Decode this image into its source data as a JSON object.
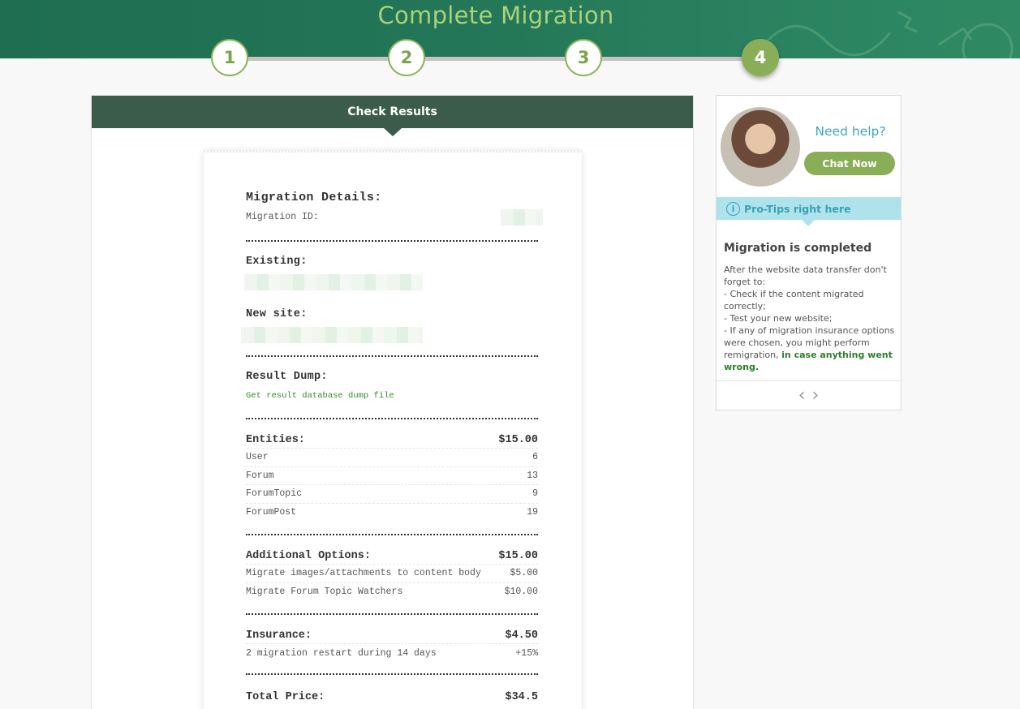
{
  "header": {
    "title": "Complete Migration"
  },
  "steps": [
    {
      "label": "1",
      "state": "done"
    },
    {
      "label": "2",
      "state": "done"
    },
    {
      "label": "3",
      "state": "done"
    },
    {
      "label": "4",
      "state": "active"
    }
  ],
  "main": {
    "title": "Check Results"
  },
  "receipt": {
    "details_title": "Migration Details:",
    "migration_id_label": "Migration ID:",
    "existing_label": "Existing:",
    "new_site_label": "New site:",
    "result_dump_label": "Result Dump:",
    "result_dump_link": "Get result database dump file",
    "entities": {
      "label": "Entities:",
      "total": "$15.00",
      "rows": [
        {
          "name": "User",
          "value": "6"
        },
        {
          "name": "Forum",
          "value": "13"
        },
        {
          "name": "ForumTopic",
          "value": "9"
        },
        {
          "name": "ForumPost",
          "value": "19"
        }
      ]
    },
    "additional": {
      "label": "Additional Options:",
      "total": "$15.00",
      "rows": [
        {
          "name": "Migrate images/attachments to content body",
          "value": "$5.00"
        },
        {
          "name": "Migrate Forum Topic Watchers",
          "value": "$10.00"
        }
      ]
    },
    "insurance": {
      "label": "Insurance:",
      "total": "$4.50",
      "rows": [
        {
          "name": "2 migration restart during 14 days",
          "value": "+15%"
        }
      ]
    },
    "total_label": "Total Price:",
    "total_value": "$34.5"
  },
  "sidebar": {
    "need_help": "Need help?",
    "chat_button": "Chat Now",
    "pro_tips": "Pro-Tips right here",
    "tip_title": "Migration is completed",
    "tip_lines": [
      "After the website data transfer don't forget to:",
      "- Check if the content migrated correctly;",
      "- Test your new website;",
      "- If any of migration insurance options were chosen, you might perform remigration, "
    ],
    "tip_highlight": "in case anything went wrong."
  },
  "colors": {
    "accent_green": "#8aae57",
    "header_green": "#237657",
    "panel_head": "#3b5c4a",
    "tips_bg": "#aee3ec"
  }
}
